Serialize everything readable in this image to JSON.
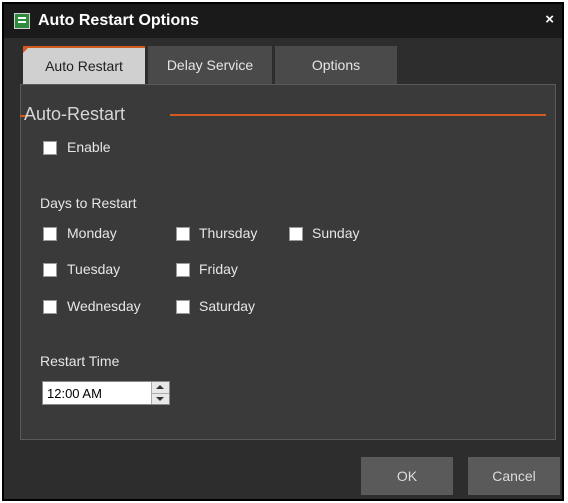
{
  "window": {
    "title": "Auto Restart Options",
    "close_glyph": "×",
    "app_icon": "app-icon"
  },
  "tabs": [
    {
      "label": "Auto Restart",
      "active": true
    },
    {
      "label": "Delay Service",
      "active": false
    },
    {
      "label": "Options",
      "active": false
    }
  ],
  "auto_restart": {
    "section_title": "Auto-Restart",
    "enable_label": "Enable",
    "enable_checked": false,
    "days_label": "Days to Restart",
    "days": [
      {
        "label": "Monday",
        "checked": false
      },
      {
        "label": "Tuesday",
        "checked": false
      },
      {
        "label": "Wednesday",
        "checked": false
      },
      {
        "label": "Thursday",
        "checked": false
      },
      {
        "label": "Friday",
        "checked": false
      },
      {
        "label": "Saturday",
        "checked": false
      },
      {
        "label": "Sunday",
        "checked": false
      }
    ],
    "time_label": "Restart Time",
    "time_value": "12:00 AM"
  },
  "buttons": {
    "ok": "OK",
    "cancel": "Cancel"
  },
  "colors": {
    "accent": "#d05a20",
    "window_bg": "#2d2d2d",
    "panel_bg": "#3a3a3a",
    "active_tab": "#d0d0d0"
  }
}
